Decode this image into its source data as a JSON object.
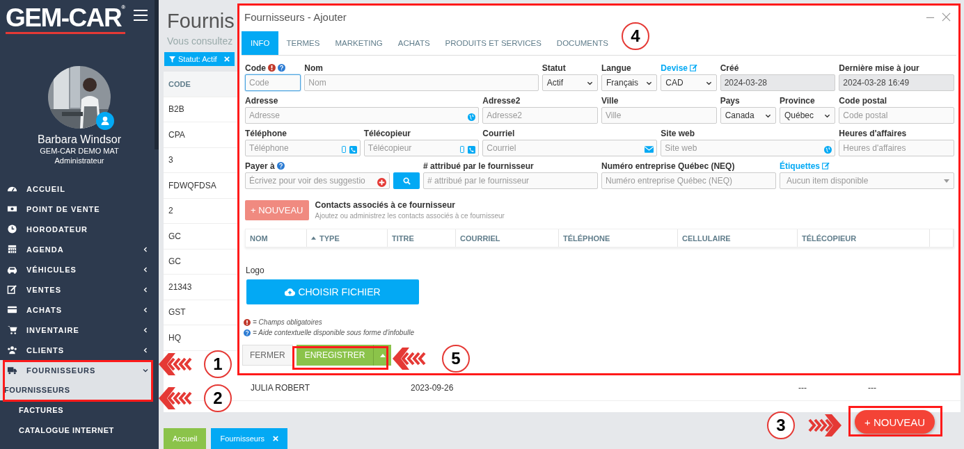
{
  "sidebar": {
    "logo": "GEM-CAR",
    "logo_mark": "®",
    "user": {
      "name": "Barbara Windsor",
      "company": "GEM-CAR DEMO MAT",
      "role": "Administrateur"
    },
    "items": [
      {
        "label": "ACCUEIL",
        "has_children": false,
        "expanded": false
      },
      {
        "label": "POINT DE VENTE",
        "has_children": false,
        "expanded": false
      },
      {
        "label": "HORODATEUR",
        "has_children": false,
        "expanded": false
      },
      {
        "label": "AGENDA",
        "has_children": true,
        "expanded": false
      },
      {
        "label": "VÉHICULES",
        "has_children": true,
        "expanded": false
      },
      {
        "label": "VENTES",
        "has_children": true,
        "expanded": false
      },
      {
        "label": "ACHATS",
        "has_children": true,
        "expanded": false
      },
      {
        "label": "INVENTAIRE",
        "has_children": true,
        "expanded": false
      },
      {
        "label": "CLIENTS",
        "has_children": true,
        "expanded": false
      },
      {
        "label": "FOURNISSEURS",
        "has_children": true,
        "expanded": true,
        "children": [
          {
            "label": "FOURNISSEURS",
            "selected": true
          },
          {
            "label": "FACTURES",
            "selected": false
          },
          {
            "label": "CATALOGUE INTERNET",
            "selected": false
          }
        ]
      }
    ]
  },
  "page": {
    "title": "Fournis",
    "subtitle": "Vous consultez",
    "filter": "Statut: Actif",
    "table": {
      "columns": [
        "CODE"
      ],
      "rows": [
        {
          "code": "B2B"
        },
        {
          "code": "CPA"
        },
        {
          "code": "3"
        },
        {
          "code": "FDWQFDSA"
        },
        {
          "code": "2"
        },
        {
          "code": "GC"
        },
        {
          "code": "GC"
        },
        {
          "code": "21343"
        },
        {
          "code": "GST"
        },
        {
          "code": "HQ"
        },
        {
          "column_2": "JULIA ROBERT",
          "column_3": "2023-09-26",
          "column_6": "---",
          "column_7": "---"
        }
      ]
    },
    "tabs": [
      {
        "label": "Accueil",
        "selected": false,
        "closable": false
      },
      {
        "label": "Fournisseurs",
        "selected": true,
        "closable": true
      }
    ],
    "new_button": "+ NOUVEAU"
  },
  "dialog": {
    "title": "Fournisseurs - Ajouter",
    "tabs": [
      {
        "label": "INFO",
        "selected": true
      },
      {
        "label": "TERMES",
        "selected": false
      },
      {
        "label": "MARKETING",
        "selected": false
      },
      {
        "label": "ACHATS",
        "selected": false
      },
      {
        "label": "PRODUITS ET SERVICES",
        "selected": false
      },
      {
        "label": "DOCUMENTS",
        "selected": false
      }
    ],
    "fields": [
      {
        "label": "Code",
        "kind": "text",
        "placeholder": "Code",
        "required": true,
        "help": true,
        "focused": true
      },
      {
        "label": "Nom",
        "kind": "text",
        "placeholder": "Nom"
      },
      {
        "label": "Statut",
        "kind": "select",
        "value": "Actif"
      },
      {
        "label": "Langue",
        "kind": "select",
        "value": "Français"
      },
      {
        "label": "Devise",
        "kind": "select",
        "value": "CAD",
        "editable_label": true
      },
      {
        "label": "Créé",
        "kind": "readonly",
        "value": "2024-03-28"
      },
      {
        "label": "Dernière mise à jour",
        "kind": "readonly",
        "value": "2024-03-28 16:49"
      },
      {
        "label": "Adresse",
        "kind": "globe",
        "placeholder": "Adresse"
      },
      {
        "label": "Adresse2",
        "kind": "text",
        "placeholder": "Adresse2"
      },
      {
        "label": "Ville",
        "kind": "text",
        "placeholder": "Ville"
      },
      {
        "label": "Pays",
        "kind": "select",
        "value": "Canada"
      },
      {
        "label": "Province",
        "kind": "select",
        "value": "Québec"
      },
      {
        "label": "Code postal",
        "kind": "text",
        "placeholder": "Code postal"
      },
      {
        "label": "Téléphone",
        "kind": "phone",
        "placeholder": "Téléphone"
      },
      {
        "label": "Télécopieur",
        "kind": "phone",
        "placeholder": "Télécopieur"
      },
      {
        "label": "Courriel",
        "kind": "email",
        "placeholder": "Courriel"
      },
      {
        "label": "Site web",
        "kind": "globe",
        "placeholder": "Site web"
      },
      {
        "label": "Heures d'affaires",
        "kind": "text",
        "placeholder": "Heures d'affaires"
      },
      {
        "label": "Payer à",
        "kind": "suggest",
        "placeholder": "Écrivez pour voir des suggestio",
        "help": true
      },
      {
        "kind": "search_button"
      },
      {
        "label": "# attribué par le fournisseur",
        "kind": "text",
        "placeholder": "# attribué par le fournisseur"
      },
      {
        "label": "Numéro entreprise Québec (NEQ)",
        "kind": "text",
        "placeholder": "Numéro entreprise Québec (NEQ)"
      },
      {
        "label": "Étiquettes",
        "kind": "tags",
        "placeholder": "Aucun item disponible",
        "editable_label": true
      }
    ],
    "contacts": {
      "button": "+ NOUVEAU",
      "title": "Contacts associés à ce fournisseur",
      "subtitle": "Ajoutez ou administrez les contacts associés à ce fournisseur",
      "columns": [
        {
          "label": "NOM",
          "sorted": false
        },
        {
          "label": "TYPE",
          "sorted": true
        },
        {
          "label": "TITRE",
          "sorted": false
        },
        {
          "label": "COURRIEL",
          "sorted": false
        },
        {
          "label": "TÉLÉPHONE",
          "sorted": false
        },
        {
          "label": "CELLULAIRE",
          "sorted": false
        },
        {
          "label": "TÉLÉCOPIEUR",
          "sorted": false
        }
      ]
    },
    "logo": {
      "label": "Logo",
      "button": "CHOISIR FICHIER"
    },
    "legend": [
      {
        "kind": "required",
        "text": "= Champs obligatoires"
      },
      {
        "kind": "help",
        "text": "= Aide contextuelle disponible sous forme d'infobulle"
      }
    ],
    "footer": {
      "close": "FERMER",
      "save": "ENREGISTRER"
    }
  },
  "annotations": [
    {
      "number": "1"
    },
    {
      "number": "2"
    },
    {
      "number": "3"
    },
    {
      "number": "4"
    },
    {
      "number": "5"
    }
  ]
}
